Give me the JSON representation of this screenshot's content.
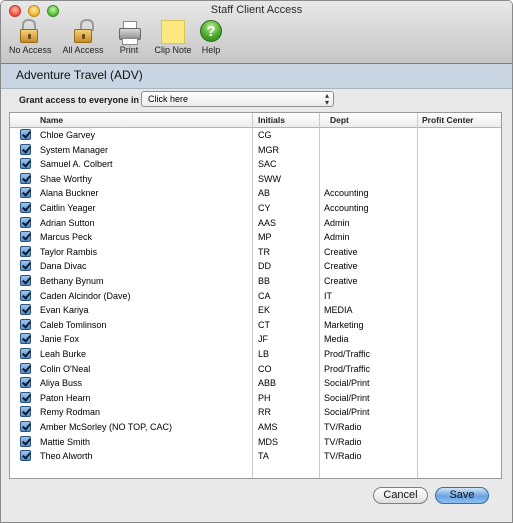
{
  "window": {
    "title": "Staff Client Access"
  },
  "toolbar": {
    "items": [
      {
        "label": "No Access",
        "icon": "lock-icon"
      },
      {
        "label": "All Access",
        "icon": "lock-icon"
      },
      {
        "label": "Print",
        "icon": "printer-icon"
      },
      {
        "label": "Clip Note",
        "icon": "note-icon"
      },
      {
        "label": "Help",
        "icon": "help-icon",
        "glyph": "?"
      }
    ]
  },
  "client": {
    "title": "Adventure Travel (ADV)"
  },
  "grant": {
    "label": "Grant access to everyone in :",
    "selected": "Click here",
    "arrows": "▴▾"
  },
  "table": {
    "headers": [
      "Name",
      "Initials",
      "Dept",
      "Profit Center"
    ],
    "rows": [
      {
        "name": "Chloe Garvey",
        "initials": "CG",
        "dept": "",
        "checked": true
      },
      {
        "name": "System Manager",
        "initials": "MGR",
        "dept": "",
        "checked": true
      },
      {
        "name": "Samuel A. Colbert",
        "initials": "SAC",
        "dept": "",
        "checked": true
      },
      {
        "name": "Shae Worthy",
        "initials": "SWW",
        "dept": "",
        "checked": true
      },
      {
        "name": "Alana Buckner",
        "initials": "AB",
        "dept": "Accounting",
        "checked": true
      },
      {
        "name": "Caitlin Yeager",
        "initials": "CY",
        "dept": "Accounting",
        "checked": true
      },
      {
        "name": "Adrian Sutton",
        "initials": "AAS",
        "dept": "Admin",
        "checked": true
      },
      {
        "name": "Marcus Peck",
        "initials": "MP",
        "dept": "Admin",
        "checked": true
      },
      {
        "name": "Taylor Rambis",
        "initials": "TR",
        "dept": "Creative",
        "checked": true
      },
      {
        "name": "Dana Divac",
        "initials": "DD",
        "dept": "Creative",
        "checked": true
      },
      {
        "name": "Bethany Bynum",
        "initials": "BB",
        "dept": "Creative",
        "checked": true
      },
      {
        "name": "Caden Alcindor (Dave)",
        "initials": "CA",
        "dept": "IT",
        "checked": true
      },
      {
        "name": "Evan Kariya",
        "initials": "EK",
        "dept": "MEDIA",
        "checked": true
      },
      {
        "name": "Caleb Tomlinson",
        "initials": "CT",
        "dept": "Marketing",
        "checked": true
      },
      {
        "name": "Janie Fox",
        "initials": "JF",
        "dept": "Media",
        "checked": true
      },
      {
        "name": "Leah Burke",
        "initials": "LB",
        "dept": "Prod/Traffic",
        "checked": true
      },
      {
        "name": "Colin O'Neal",
        "initials": "CO",
        "dept": "Prod/Traffic",
        "checked": true
      },
      {
        "name": "Aliya Buss",
        "initials": "ABB",
        "dept": "Social/Print",
        "checked": true
      },
      {
        "name": "Paton Hearn",
        "initials": "PH",
        "dept": "Social/Print",
        "checked": true
      },
      {
        "name": "Remy Rodman",
        "initials": "RR",
        "dept": "Social/Print",
        "checked": true
      },
      {
        "name": "Amber McSorley (NO TOP, CAC)",
        "initials": "AMS",
        "dept": "TV/Radio",
        "checked": true
      },
      {
        "name": "Mattie Smith",
        "initials": "MDS",
        "dept": "TV/Radio",
        "checked": true
      },
      {
        "name": "Theo Alworth",
        "initials": "TA",
        "dept": "TV/Radio",
        "checked": true
      }
    ]
  },
  "buttons": {
    "cancel": "Cancel",
    "save": "Save"
  }
}
